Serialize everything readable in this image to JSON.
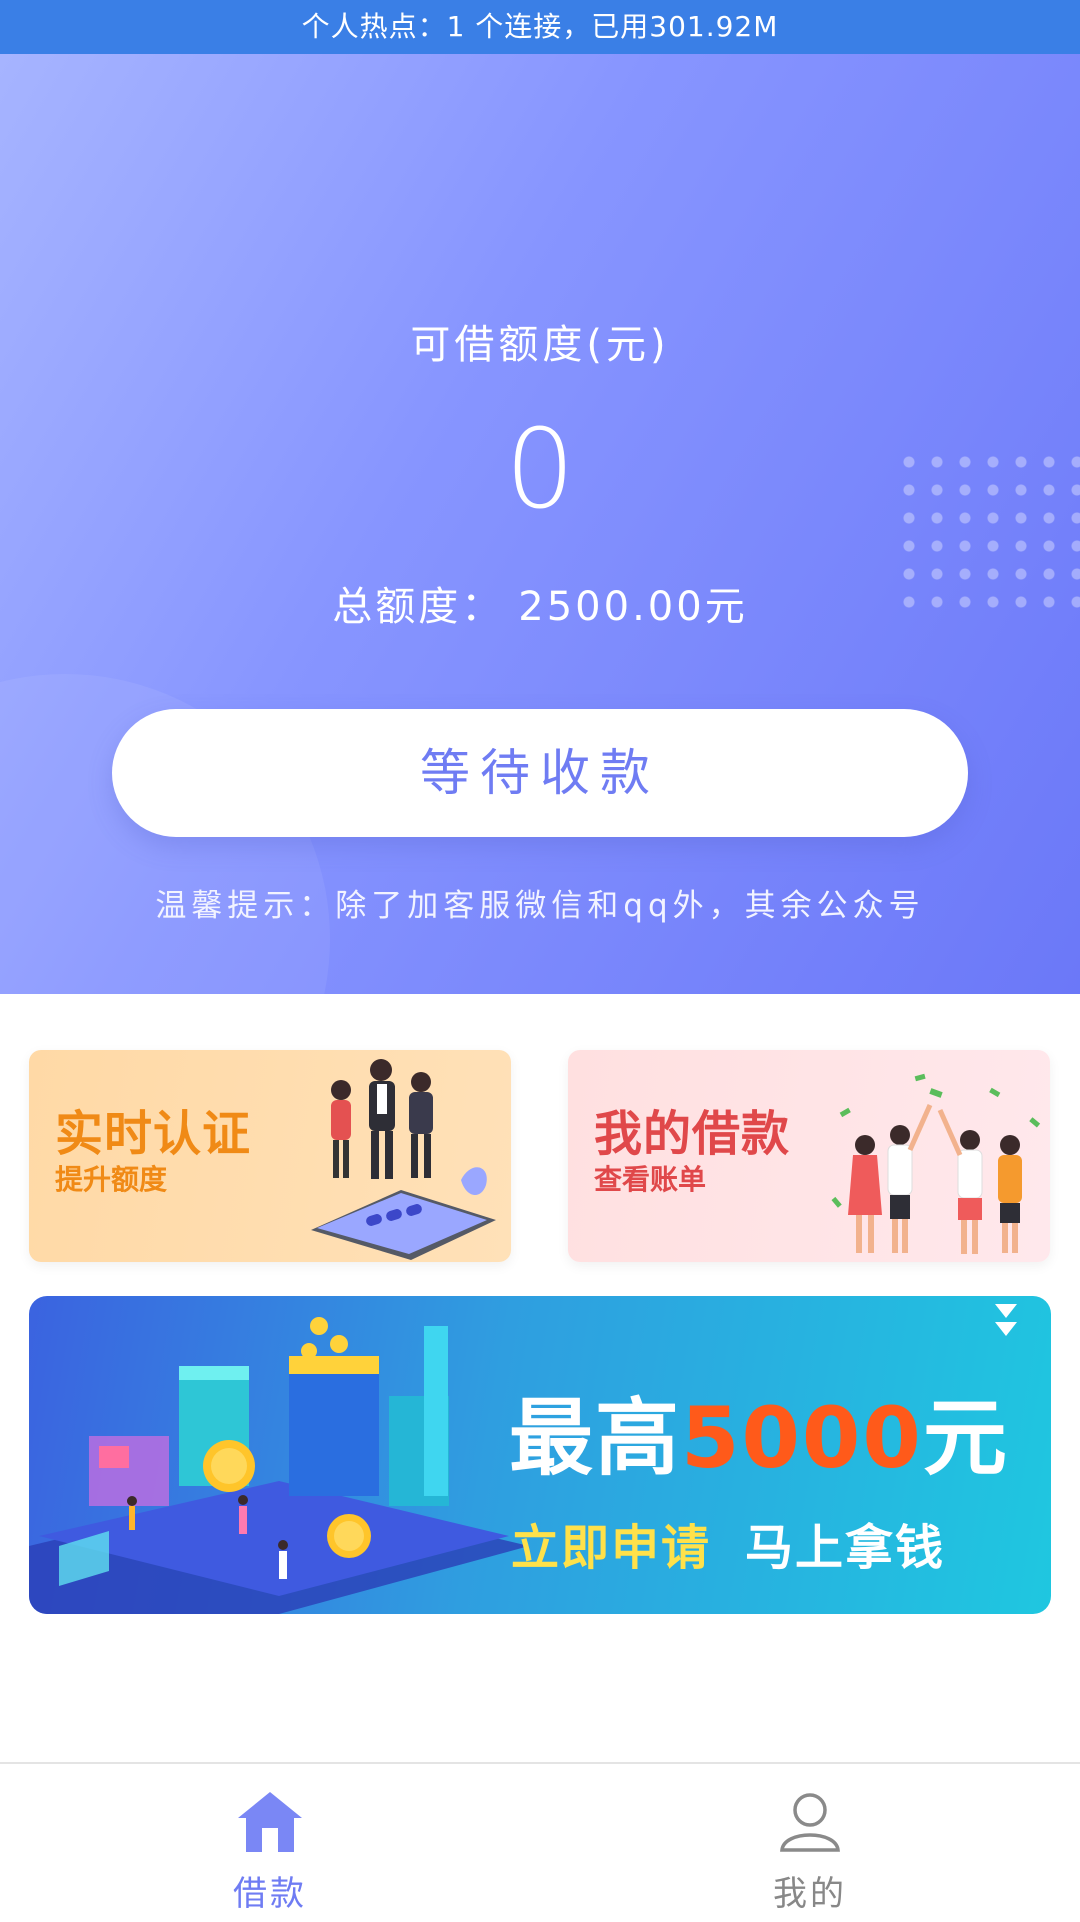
{
  "status_bar": {
    "text": "个人热点：1 个连接，已用301.92M"
  },
  "hero": {
    "limit_label": "可借额度(元)",
    "limit_value": "0",
    "total_label": "总额度：",
    "total_value": "2500.00元",
    "button_label": "等待收款",
    "tip": "温馨提示：除了加客服微信和qq外，其余公众号"
  },
  "cards": [
    {
      "title": "实时认证",
      "subtitle": "提升额度"
    },
    {
      "title": "我的借款",
      "subtitle": "查看账单"
    }
  ],
  "banner": {
    "prefix": "最高",
    "amount": "5000",
    "suffix": "元",
    "cta_left": "立即申请",
    "cta_right": "马上拿钱"
  },
  "tabbar": {
    "items": [
      {
        "label": "借款",
        "icon": "home-icon",
        "active": true
      },
      {
        "label": "我的",
        "icon": "user-icon",
        "active": false
      }
    ]
  },
  "colors": {
    "status_bar": "#3a7fe6",
    "hero_start": "#a6b4ff",
    "hero_end": "#6b78f8",
    "accent": "#6f7cf3",
    "card_left_text": "#f08a16",
    "card_right_text": "#e0484a",
    "banner_highlight": "#ff5a1a",
    "banner_cta": "#ffe14a"
  }
}
